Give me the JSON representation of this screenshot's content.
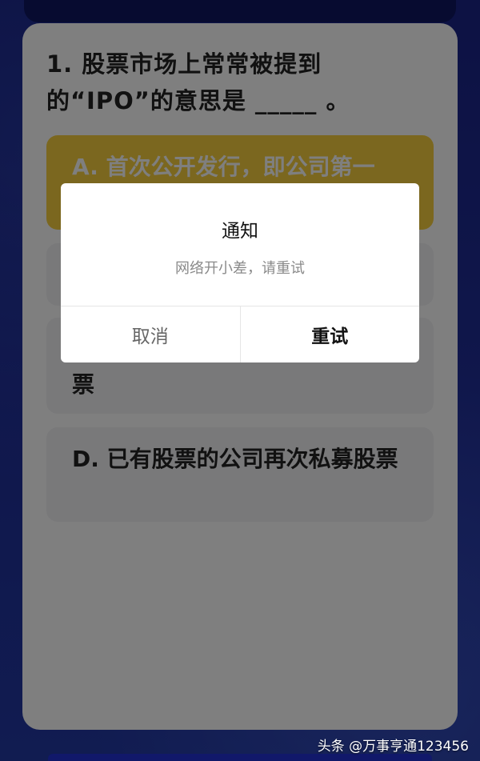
{
  "question": {
    "text": "1. 股票市场上常常被提到的“IPO”的意思是 _____ 。"
  },
  "options": [
    {
      "label": "A. 首次公开发行，即公司第一"
    },
    {
      "label": ""
    },
    {
      "label": "票"
    },
    {
      "label": "D. 已有股票的公司再次私募股票"
    }
  ],
  "dialog": {
    "title": "通知",
    "message": "网络开小差，请重试",
    "cancel_label": "取消",
    "confirm_label": "重试"
  },
  "watermark": "头条 @万事亨通123456",
  "colors": {
    "background": "#1f2a8e",
    "selected_option": "#f7ce3e",
    "option": "#f2f2f4"
  }
}
